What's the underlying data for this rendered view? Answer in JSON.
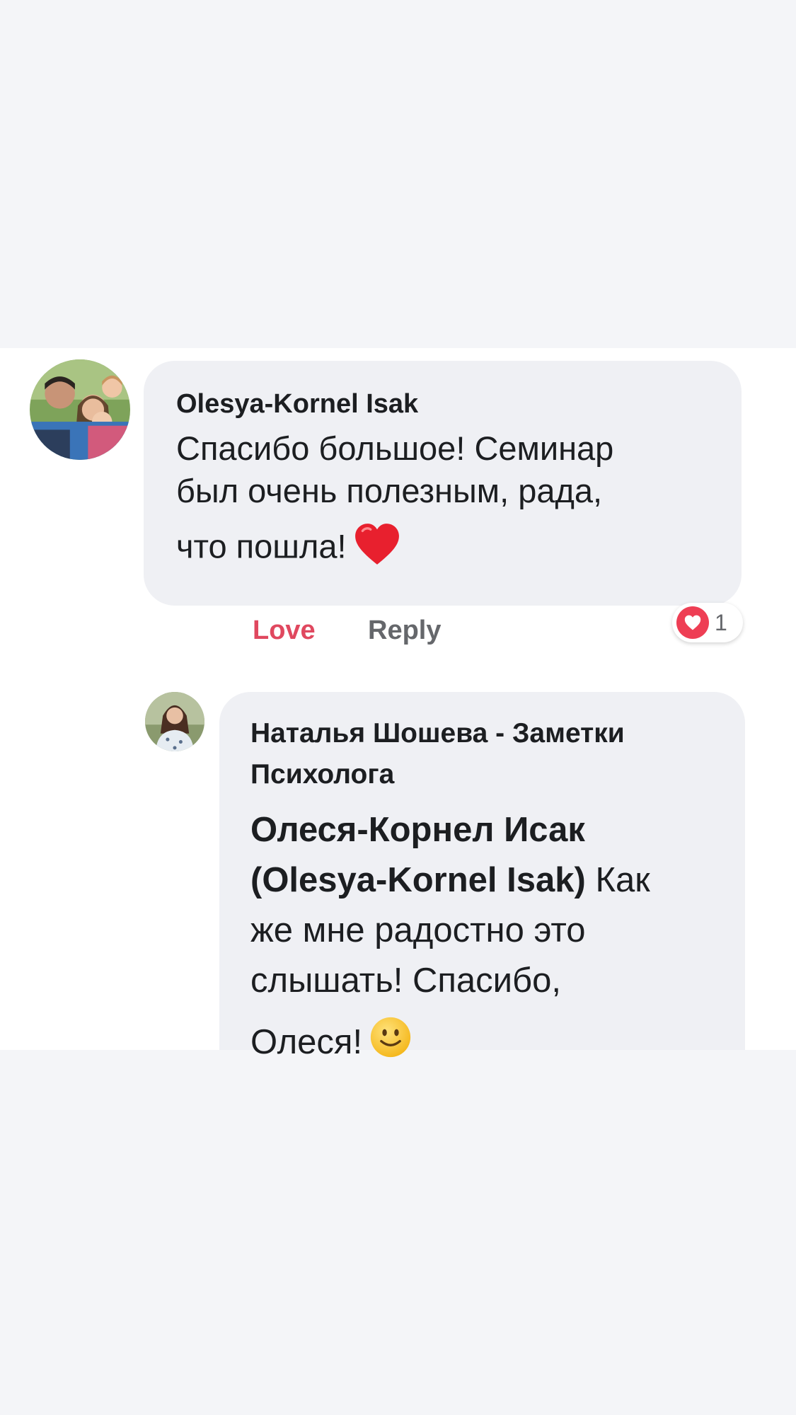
{
  "comment": {
    "author": "Olesya-Kornel Isak",
    "text_lines": [
      "Спасибо большое! Семинар",
      "был очень полезным,  рада,",
      "что пошла!"
    ],
    "emoji": "red-heart-icon",
    "actions": {
      "love_label": "Love",
      "reply_label": "Reply"
    },
    "reaction": {
      "icon": "heart-reaction-icon",
      "count": "1",
      "color": "#ee3e54"
    }
  },
  "reply": {
    "author_line1": "Наталья Шошева - Заметки",
    "author_line2": "Психолога",
    "mention_line1": "Олеся-Корнел Исак",
    "mention_line2": "(Olesya-Kornel Isak)",
    "text_after_mention": " Как",
    "text_lines": [
      "же мне радостно это",
      "слышать! Спасибо,",
      "Олеся!"
    ],
    "emoji": "smiling-face-icon"
  },
  "colors": {
    "love_active": "#e0485f",
    "secondary_text": "#65676b",
    "bubble_bg": "#eff0f4",
    "page_bg": "#f4f5f8"
  }
}
